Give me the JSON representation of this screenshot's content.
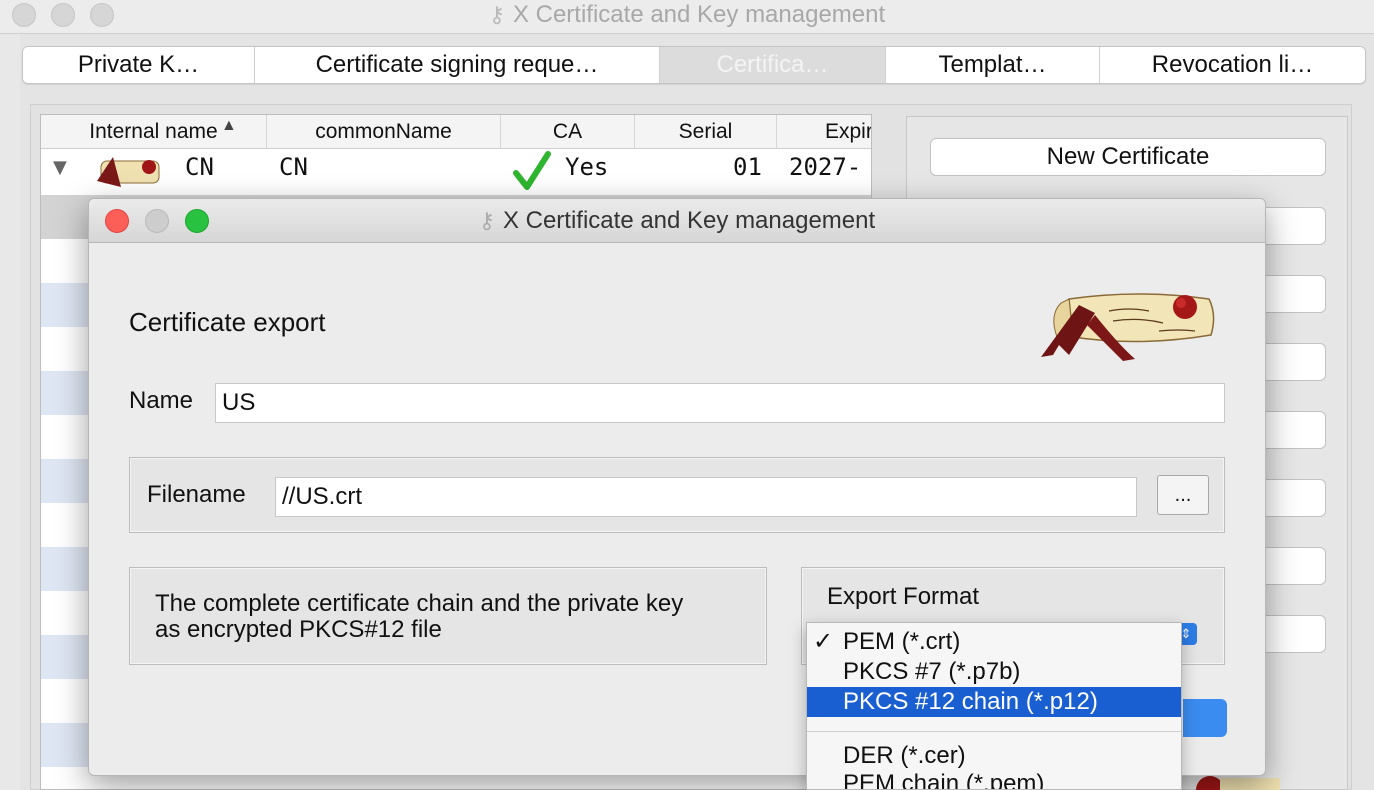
{
  "main_window": {
    "title": "X Certificate and Key management",
    "tabs": [
      {
        "label": "Private K…"
      },
      {
        "label": "Certificate signing reque…"
      },
      {
        "label": "Certifica…"
      },
      {
        "label": "Templat…"
      },
      {
        "label": "Revocation li…"
      }
    ],
    "table": {
      "columns": [
        "Internal name",
        "commonName",
        "CA",
        "Serial",
        "Expiry"
      ],
      "sort_indicator": "▲",
      "rows": [
        {
          "internal_name": "CN",
          "common_name": "CN",
          "ca": "Yes",
          "serial": "01",
          "expiry": "2027-"
        }
      ]
    },
    "buttons": {
      "new_certificate": "New Certificate"
    }
  },
  "dialog": {
    "title": "X Certificate and Key management",
    "heading": "Certificate export",
    "name_label": "Name",
    "name_value": "US",
    "filename_label": "Filename",
    "filename_value": "//US.crt",
    "browse_label": "...",
    "description_line1": "The complete certificate chain and the private key",
    "description_line2": "as encrypted PKCS#12 file",
    "export_format_label": "Export Format"
  },
  "format_dropdown": {
    "items": [
      {
        "label": "PEM (*.crt)",
        "checked": true
      },
      {
        "label": "PKCS #7 (*.p7b)"
      },
      {
        "label": "PKCS #12 chain (*.p12)",
        "highlighted": true
      },
      {
        "label": "DER (*.cer)"
      },
      {
        "label": "PEM chain (*.pem)"
      }
    ]
  },
  "colors": {
    "highlight": "#1a5fd1",
    "checkmark": "#2fb52f",
    "close": "#fc5f57",
    "zoom": "#29c140"
  }
}
